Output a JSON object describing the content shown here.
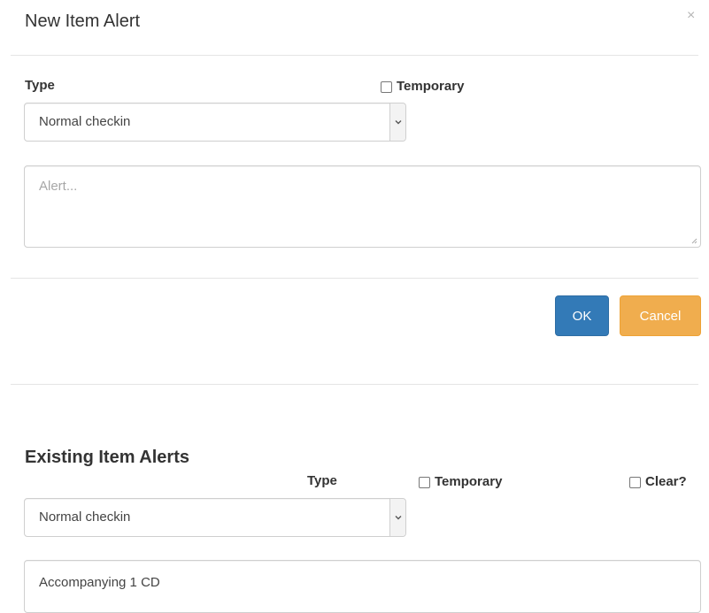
{
  "new_alert": {
    "title": "New Item Alert",
    "close_symbol": "×",
    "type_label": "Type",
    "temporary_label": "Temporary",
    "type_selected": "Normal checkin",
    "alert_placeholder": "Alert...",
    "ok_label": "OK",
    "cancel_label": "Cancel"
  },
  "existing_alerts": {
    "title": "Existing Item Alerts",
    "type_label": "Type",
    "temporary_label": "Temporary",
    "clear_label": "Clear?",
    "type_selected": "Normal checkin",
    "alert_text": "Accompanying 1 CD"
  },
  "colors": {
    "primary": "#337ab7",
    "warning": "#f0ad4e"
  },
  "icons": {
    "close": "close-icon",
    "select_arrow": "chevron-down-icon",
    "resize": "resize-grip-icon"
  }
}
